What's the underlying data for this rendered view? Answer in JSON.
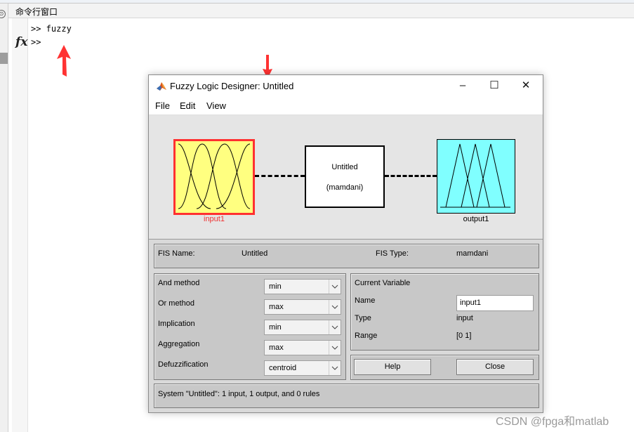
{
  "command_window": {
    "title": "命令行窗口",
    "lines": [
      ">> fuzzy",
      ">>"
    ],
    "prompt_icon": "fx"
  },
  "fuzzy_window": {
    "title": "Fuzzy Logic Designer: Untitled",
    "icon": "matlab-logo-icon",
    "window_controls": [
      "minimize",
      "maximize",
      "close"
    ],
    "menu": [
      "File",
      "Edit",
      "View"
    ],
    "diagram": {
      "input_label": "input1",
      "fis_name": "Untitled",
      "fis_type": "(mamdani)",
      "output_label": "output1",
      "input_color": "#ffff80",
      "input_border": "#ff3030",
      "output_color": "#80ffff"
    },
    "fis_info": {
      "name_label": "FIS Name:",
      "name_value": "Untitled",
      "type_label": "FIS Type:",
      "type_value": "mamdani"
    },
    "methods": [
      {
        "label": "And method",
        "value": "min"
      },
      {
        "label": "Or method",
        "value": "max"
      },
      {
        "label": "Implication",
        "value": "min"
      },
      {
        "label": "Aggregation",
        "value": "max"
      },
      {
        "label": "Defuzzification",
        "value": "centroid"
      }
    ],
    "current_variable": {
      "title": "Current Variable",
      "name_label": "Name",
      "name_value": "input1",
      "type_label": "Type",
      "type_value": "input",
      "range_label": "Range",
      "range_value": "[0 1]"
    },
    "buttons": {
      "help": "Help",
      "close": "Close"
    },
    "status": "System \"Untitled\": 1 input, 1 output, and 0 rules"
  },
  "watermark": "CSDN @fpga和matlab",
  "annotation_color": "#ff3333"
}
